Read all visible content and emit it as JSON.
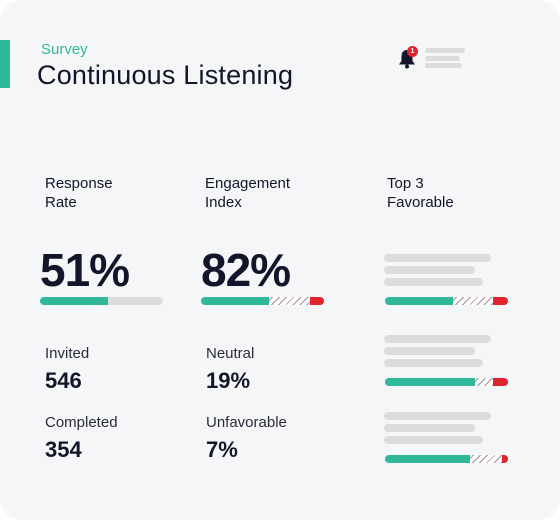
{
  "header": {
    "eyebrow": "Survey",
    "title": "Continuous Listening",
    "notification_count": "1",
    "notification_icon": "bell-icon"
  },
  "colors": {
    "accent": "#2fb899",
    "favorable": "#2fb899",
    "unfavorable": "#e0252f",
    "text": "#14152a",
    "placeholder": "#dcdcdd"
  },
  "metrics": {
    "response_rate": {
      "label_line1": "Response",
      "label_line2": "Rate",
      "value": "51%",
      "progress": 0.55
    },
    "engagement_index": {
      "label_line1": "Engagement",
      "label_line2": "Index",
      "value": "82%",
      "favorable": 0.55,
      "neutral": 0.34,
      "unfavorable": 0.11
    },
    "top3": {
      "label_line1": "Top 3",
      "label_line2": "Favorable",
      "items": [
        {
          "favorable": 0.55,
          "neutral": 0.33,
          "unfavorable": 0.12
        },
        {
          "favorable": 0.73,
          "neutral": 0.15,
          "unfavorable": 0.12
        },
        {
          "favorable": 0.69,
          "neutral": 0.26,
          "unfavorable": 0.05
        }
      ]
    }
  },
  "stats": {
    "invited_label": "Invited",
    "invited_value": "546",
    "completed_label": "Completed",
    "completed_value": "354",
    "neutral_label": "Neutral",
    "neutral_value": "19%",
    "unfavorable_label": "Unfavorable",
    "unfavorable_value": "7%"
  }
}
